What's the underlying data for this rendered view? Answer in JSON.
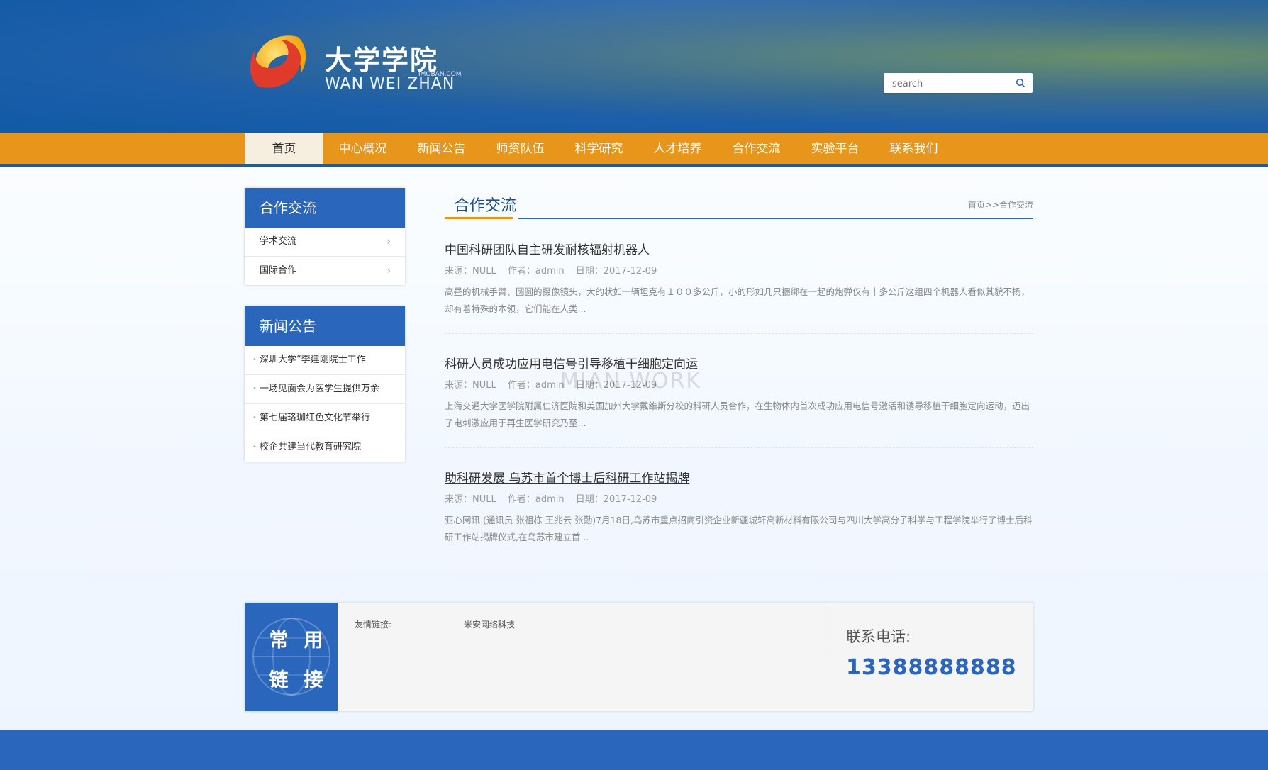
{
  "header": {
    "logo_cn": "大学学院",
    "logo_en": "WAN WEI ZHAN",
    "logo_small": "IMOBAN.COM",
    "search_placeholder": "search"
  },
  "nav": {
    "items": [
      "首页",
      "中心概况",
      "新闻公告",
      "师资队伍",
      "科学研究",
      "人才培养",
      "合作交流",
      "实验平台",
      "联系我们"
    ],
    "active_index": 0
  },
  "sidebar": {
    "panels": [
      {
        "title": "合作交流",
        "items": [
          "学术交流",
          "国际合作"
        ]
      },
      {
        "title": "新闻公告",
        "items": [
          "深圳大学“李建刚院士工作",
          "一场见面会为医学生提供万余",
          "第七届珞珈红色文化节举行",
          "校企共建当代教育研究院"
        ]
      }
    ]
  },
  "main": {
    "title": "合作交流",
    "breadcrumb": "首页>>合作交流",
    "articles": [
      {
        "title": "中国科研团队自主研发耐核辐射机器人",
        "source": "来源：NULL",
        "author": "作者：admin",
        "date": "日期：2017-12-09",
        "excerpt": "高昼的机械手臂、圆圆的摄像镜头，大的状如一辆坦克有１００多公斤，小的形如几只捆绑在一起的炮弹仅有十多公斤这组四个机器人看似其貌不扬，却有着特殊的本领，它们能在人类..."
      },
      {
        "title": "科研人员成功应用电信号引导移植干细胞定向运",
        "source": "来源：NULL",
        "author": "作者：admin",
        "date": "日期：2017-12-09",
        "excerpt": "上海交通大学医学院附属仁济医院和美国加州大学戴维斯分校的科研人员合作，在生物体内首次成功应用电信号激活和诱导移植干细胞定向运动，迈出了电刺激应用于再生医学研究乃至..."
      },
      {
        "title": "助科研发展 乌苏市首个博士后科研工作站揭牌",
        "source": "来源：NULL",
        "author": "作者：admin",
        "date": "日期：2017-12-09",
        "excerpt": "亚心网讯 (通讯员 张祖栋 王兆云 张勤)7月18日,乌苏市重点招商引资企业新疆城轩高新材料有限公司与四川大学高分子科学与工程学院举行了博士后科研工作站揭牌仪式,在乌苏市建立首..."
      }
    ],
    "watermark": "MIAN WORK"
  },
  "footer": {
    "badge_line1": "常用",
    "badge_line2": "链接",
    "links_label": "友情链接:",
    "links": [
      "米安网络科技"
    ],
    "phone_label": "联系电话:",
    "phone_number": "13388888888"
  },
  "colors": {
    "primary_blue": "#2a66bb",
    "nav_orange": "#e8961b"
  }
}
